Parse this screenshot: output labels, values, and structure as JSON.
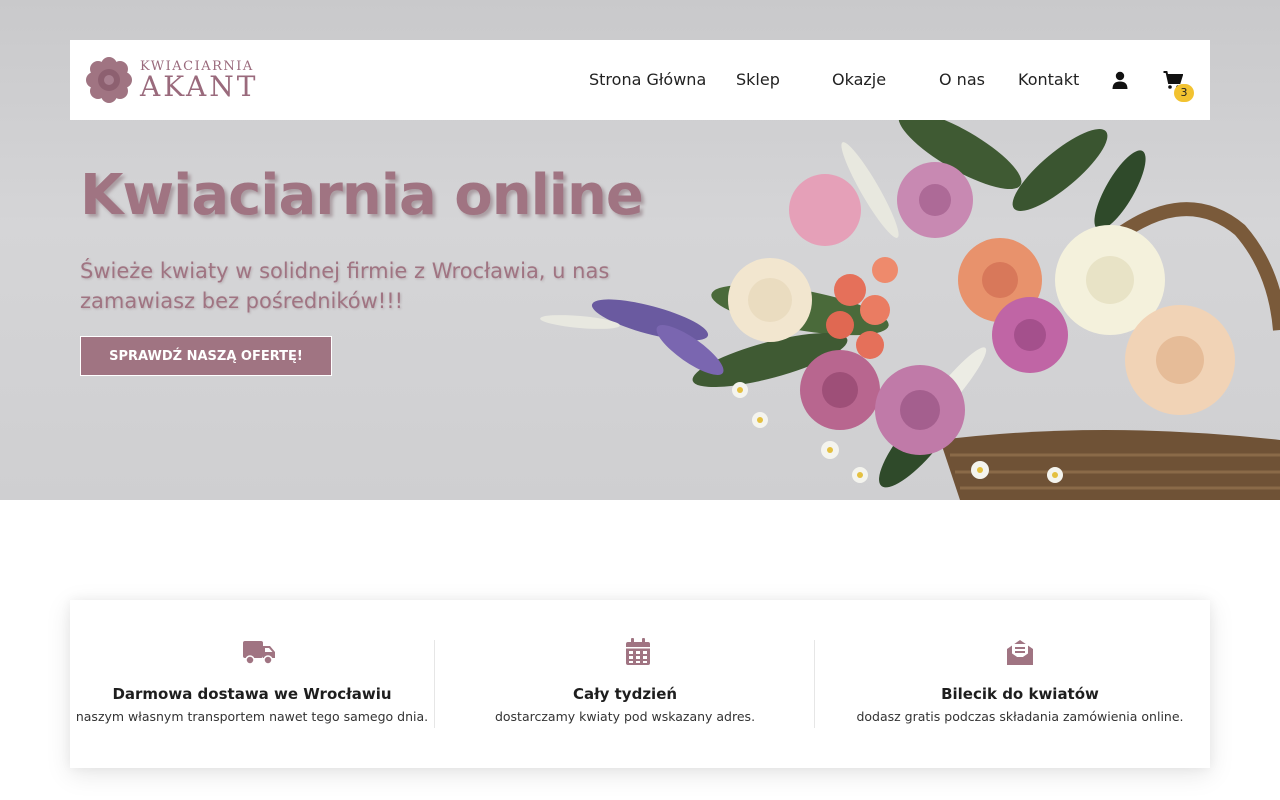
{
  "brand": {
    "name_top": "KWIACIARNIA",
    "name_bottom": "AKANT",
    "accent_color": "#a07482",
    "badge_color": "#f2c230"
  },
  "nav": {
    "items": [
      {
        "label": "Strona Główna"
      },
      {
        "label": "Sklep"
      },
      {
        "label": "Okazje"
      },
      {
        "label": "O nas"
      },
      {
        "label": "Kontakt"
      }
    ],
    "user_icon": "user-icon",
    "cart_icon": "cart-icon",
    "cart_count": "3"
  },
  "hero": {
    "title": "Kwiaciarnia online",
    "subtitle": "Świeże kwiaty w solidnej firmie z Wrocławia, u nas zamawiasz bez pośredników!!!",
    "cta_label": "SPRAWDŹ NASZĄ OFERTĘ!"
  },
  "features": [
    {
      "icon": "truck-icon",
      "title": "Darmowa dostawa we Wrocławiu",
      "description": "naszym własnym transportem nawet tego samego dnia."
    },
    {
      "icon": "calendar-icon",
      "title": "Cały tydzień",
      "description": "dostarczamy kwiaty pod wskazany adres."
    },
    {
      "icon": "envelope-icon",
      "title": "Bilecik do kwiatów",
      "description": "dodasz gratis podczas składania zamówienia online."
    }
  ]
}
